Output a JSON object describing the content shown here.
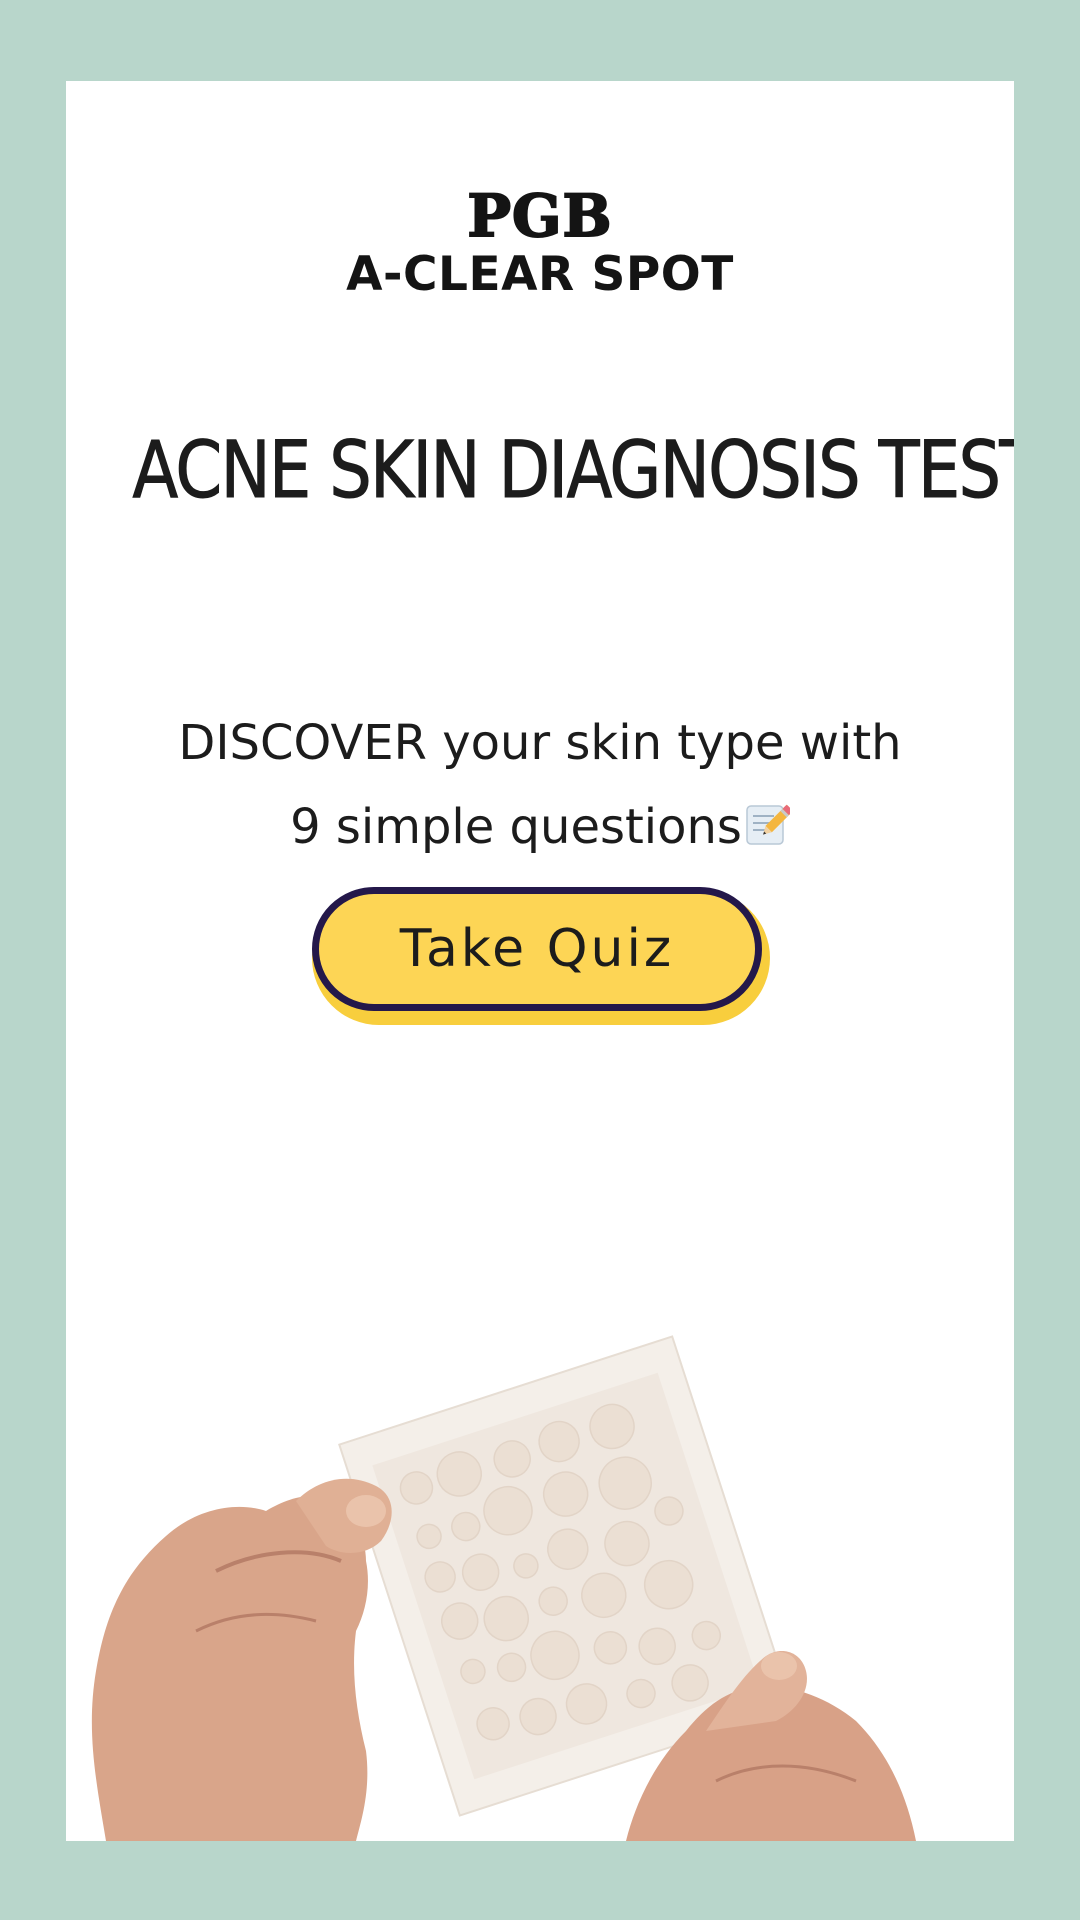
{
  "brand": {
    "logo_text": "PGB",
    "product_name": "A-CLEAR SPOT"
  },
  "hero_title": "ACNE SKIN DIAGNOSIS TEST",
  "subtitle": {
    "line1": "DISCOVER your skin type with",
    "line2": "9 simple questions",
    "icon": "memo-pencil-icon"
  },
  "cta": {
    "label": "Take Quiz"
  },
  "hero_image": {
    "icon": "hands-holding-acne-patch-sheet"
  },
  "colors": {
    "background": "#b8d6cb",
    "card": "#ffffff",
    "button_fill": "#fdd555",
    "button_border": "#24184a",
    "button_shadow": "#f8ce3d",
    "text": "#1c1c1c"
  }
}
